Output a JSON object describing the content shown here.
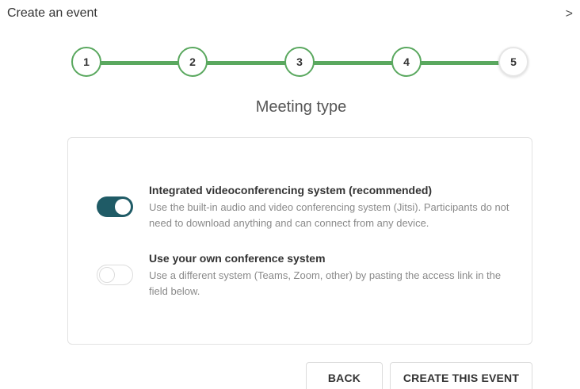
{
  "header": {
    "title": "Create an event",
    "chevron_icon": "chevron-right-icon",
    "chevron_glyph": ">"
  },
  "stepper": {
    "steps": [
      "1",
      "2",
      "3",
      "4",
      "5"
    ],
    "current_step": 5,
    "line_color": "#5aa85f"
  },
  "section": {
    "title": "Meeting type"
  },
  "options": [
    {
      "title": "Integrated videoconferencing system (recommended)",
      "description": "Use the built-in audio and video conferencing system (Jitsi). Participants do not need to download anything and can connect from any device.",
      "enabled": true
    },
    {
      "title": "Use your own conference system",
      "description": "Use a different system (Teams, Zoom, other) by pasting the access link in the field below.",
      "enabled": false
    }
  ],
  "buttons": {
    "back_label": "BACK",
    "create_label": "CREATE THIS EVENT"
  },
  "colors": {
    "accent": "#1f5b66",
    "step_green": "#5aa85f"
  }
}
